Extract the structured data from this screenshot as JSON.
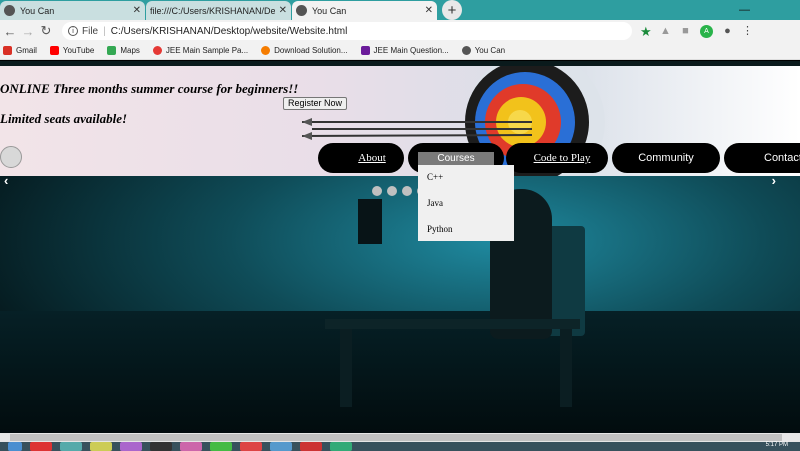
{
  "browser": {
    "tabs": [
      {
        "title": "You Can",
        "active": false
      },
      {
        "title": "file:///C:/Users/KRISHANAN/Desk",
        "active": false
      },
      {
        "title": "You Can",
        "active": true
      }
    ],
    "new_tab": "+",
    "minimize": "—",
    "url_scheme": "File",
    "url": "C:/Users/KRISHANAN/Desktop/website/Website.html",
    "bookmarks": [
      {
        "label": "Gmail",
        "color": "#d93025"
      },
      {
        "label": "YouTube",
        "color": "#ff0000"
      },
      {
        "label": "Maps",
        "color": "#34a853"
      },
      {
        "label": "JEE Main Sample Pa...",
        "color": "#e53935"
      },
      {
        "label": "Download Solution...",
        "color": "#f57c00"
      },
      {
        "label": "JEE Main Question...",
        "color": "#6a1b9a"
      },
      {
        "label": "You Can",
        "color": "#555555"
      }
    ]
  },
  "banner": {
    "line1": "ONLINE Three months summer course for beginners!!",
    "line2": "Limited seats available!",
    "register_label": "Register Now"
  },
  "nav": {
    "about": "About",
    "courses": "Courses",
    "code_to_play": "Code to Play",
    "community": "Community",
    "contact": "Contact"
  },
  "courses_menu": [
    "C++",
    "Java",
    "Python"
  ],
  "slider": {
    "prev": "‹",
    "next": "›",
    "dot_count": 4
  },
  "taskbar": {
    "clock": "5:17 PM"
  }
}
